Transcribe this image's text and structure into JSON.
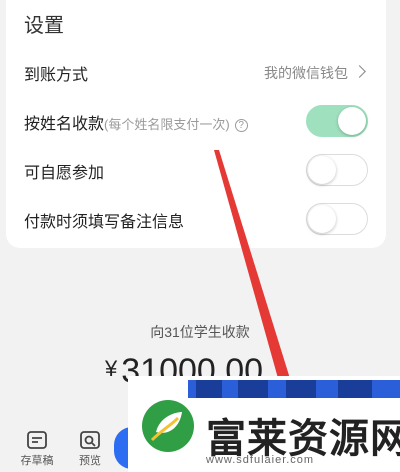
{
  "settings": {
    "title": "设置",
    "rows": [
      {
        "label": "到账方式",
        "value": "我的微信钱包"
      },
      {
        "label": "按姓名收款",
        "hint": "(每个姓名限支付一次)",
        "enabled": true
      },
      {
        "label": "可自愿参加",
        "enabled": false
      },
      {
        "label": "付款时须填写备注信息",
        "enabled": false
      }
    ]
  },
  "summary": {
    "students_text": "向31位学生收款",
    "currency": "¥",
    "amount": "31000.00"
  },
  "bottom": {
    "draft_label": "存草稿",
    "preview_label": "预览"
  },
  "watermark": {
    "title": "富莱资源网",
    "url": "www.sdfulaier.com"
  },
  "colors": {
    "toggle_on": "#9fe1bf",
    "arrow": "#e53935",
    "primary_blue": "#2d6df2"
  }
}
